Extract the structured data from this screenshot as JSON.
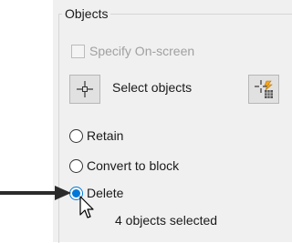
{
  "group": {
    "title": "Objects"
  },
  "specify_onscreen": {
    "label": "Specify On-screen",
    "checked": false,
    "enabled": false
  },
  "select_objects": {
    "label": "Select objects",
    "icon": "pick-point-icon"
  },
  "quick_select": {
    "icon": "quick-select-icon"
  },
  "options": [
    {
      "label": "Retain",
      "selected": false
    },
    {
      "label": "Convert to block",
      "selected": false
    },
    {
      "label": "Delete",
      "selected": true
    }
  ],
  "status": {
    "text": "4 objects selected"
  },
  "colors": {
    "accent": "#0078d7",
    "panel_bg": "#f0f0f0",
    "arrow": "#2b2b2b"
  }
}
